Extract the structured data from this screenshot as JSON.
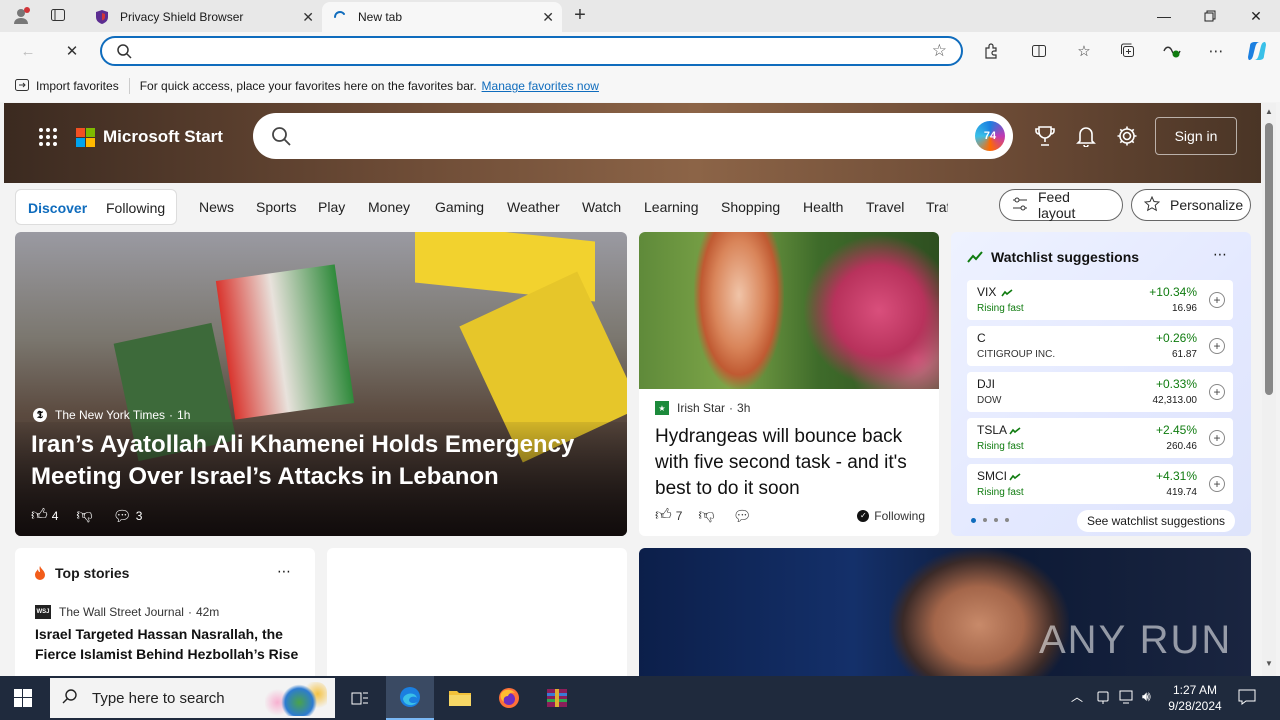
{
  "browser": {
    "tabs": [
      {
        "title": "Privacy Shield Browser",
        "active": false
      },
      {
        "title": "New tab",
        "active": true
      }
    ],
    "window_controls": [
      "minimize",
      "restore",
      "close"
    ],
    "address": {
      "value": "",
      "placeholder": ""
    },
    "favorites_bar": {
      "import_label": "Import favorites",
      "hint": "For quick access, place your favorites here on the favorites bar.",
      "manage_link": "Manage favorites now"
    }
  },
  "page": {
    "brand": "Microsoft Start",
    "search": {
      "placeholder": "",
      "copilot_badge": "74"
    },
    "sign_in": "Sign in",
    "nav": {
      "discover": "Discover",
      "following": "Following",
      "items": [
        "News",
        "Sports",
        "Play",
        "Money",
        "Gaming",
        "Weather",
        "Watch",
        "Learning",
        "Shopping",
        "Health",
        "Travel",
        "Traf"
      ],
      "feed_layout": "Feed layout",
      "personalize": "Personalize"
    },
    "lead_story": {
      "source": "The New York Times",
      "age": "1h",
      "title": "Iran’s Ayatollah Ali Khamenei Holds Emergency Meeting Over Israel’s Attacks in Lebanon",
      "likes": "4",
      "comments": "3"
    },
    "side_story": {
      "source": "Irish Star",
      "age": "3h",
      "title": "Hydrangeas will bounce back with five second task - and it's best to do it soon",
      "likes": "7",
      "following_label": "Following"
    },
    "watchlist": {
      "title": "Watchlist suggestions",
      "items": [
        {
          "symbol": "VIX",
          "sub": "Rising fast",
          "change": "+10.34%",
          "price": "16.96",
          "trend": true
        },
        {
          "symbol": "C",
          "sub": "CITIGROUP INC.",
          "change": "+0.26%",
          "price": "61.87",
          "trend": false
        },
        {
          "symbol": "DJI",
          "sub": "DOW",
          "change": "+0.33%",
          "price": "42,313.00",
          "trend": false
        },
        {
          "symbol": "TSLA",
          "sub": "Rising fast",
          "change": "+2.45%",
          "price": "260.46",
          "trend": true
        },
        {
          "symbol": "SMCI",
          "sub": "Rising fast",
          "change": "+4.31%",
          "price": "419.74",
          "trend": true
        }
      ],
      "see_more": "See watchlist suggestions",
      "colors": {
        "positive": "#107c10",
        "rising": "#107c10"
      }
    },
    "top_stories": {
      "title": "Top stories",
      "source": "The Wall Street Journal",
      "age": "42m",
      "headline": "Israel Targeted Hassan Nasrallah, the Fierce Islamist Behind Hezbollah’s Rise"
    },
    "watermark": "ANY RUN"
  },
  "taskbar": {
    "search_placeholder": "Type here to search",
    "time": "1:27 AM",
    "date": "9/28/2024"
  },
  "colors": {
    "accent": "#0f6cbd",
    "taskbar": "#1f2a3d"
  }
}
